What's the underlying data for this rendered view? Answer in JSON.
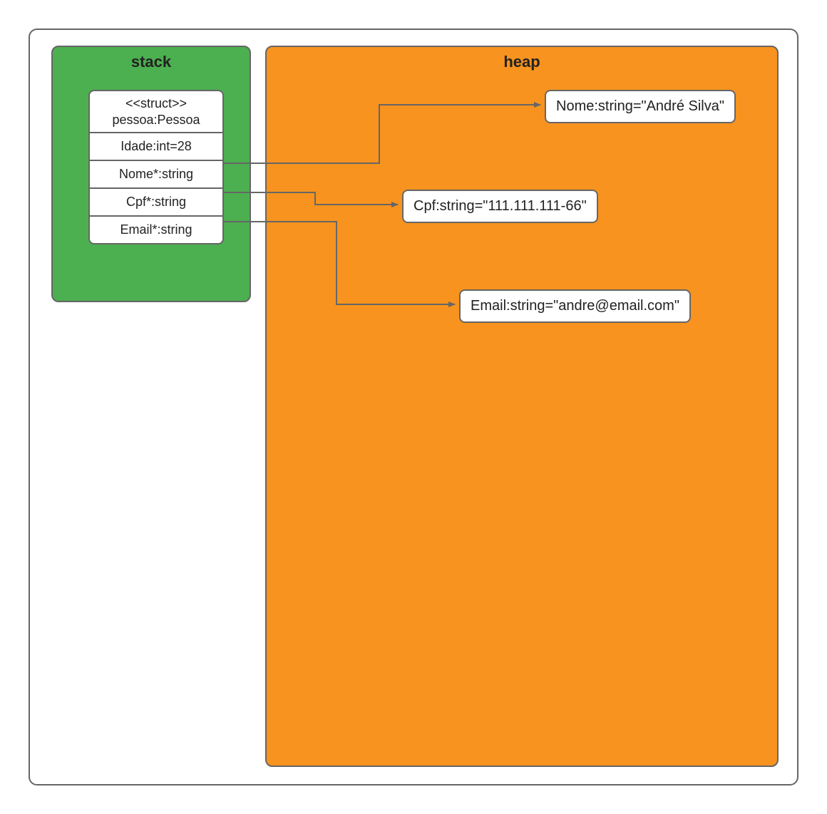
{
  "stack": {
    "title": "stack",
    "struct": {
      "stereotype": "<<struct>>",
      "name": "pessoa:Pessoa",
      "fields": [
        {
          "label": "Idade:int=28"
        },
        {
          "label": "Nome*:string"
        },
        {
          "label": "Cpf*:string"
        },
        {
          "label": "Email*:string"
        }
      ]
    }
  },
  "heap": {
    "title": "heap",
    "objects": [
      {
        "id": "nome",
        "label": "Nome:string=\"André Silva\""
      },
      {
        "id": "cpf",
        "label": "Cpf:string=\"111.111.111-66\""
      },
      {
        "id": "email",
        "label": "Email:string=\"andre@email.com\""
      }
    ]
  },
  "colors": {
    "stack": "#4caf50",
    "heap": "#f7931e",
    "border": "#666666",
    "arrow": "#666666"
  }
}
